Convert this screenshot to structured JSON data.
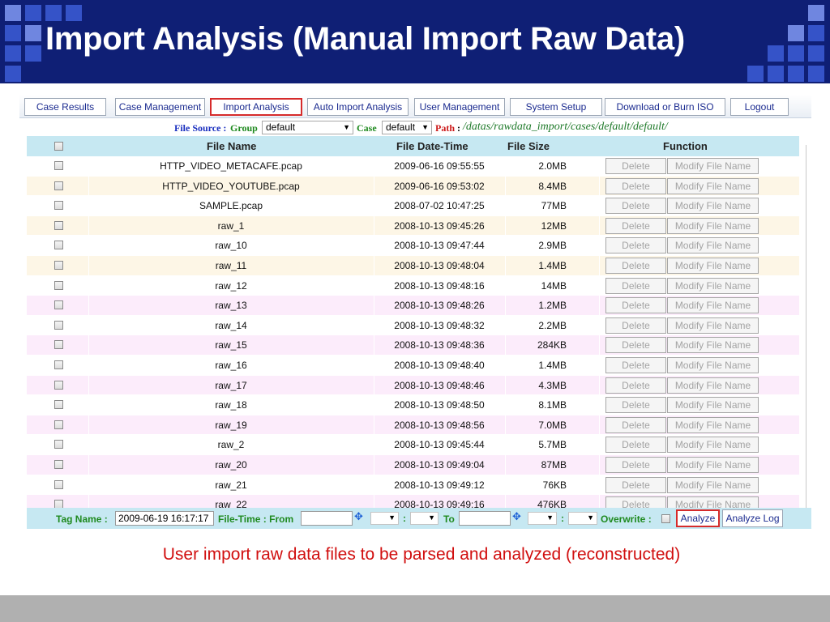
{
  "slide": {
    "title": "Import Analysis (Manual Import Raw Data)",
    "caption": "User import raw data files to be parsed and analyzed (reconstructed)"
  },
  "menu": [
    {
      "label": "Case Results"
    },
    {
      "label": "Case Management"
    },
    {
      "label": "Import Analysis"
    },
    {
      "label": "Auto Import Analysis"
    },
    {
      "label": "User Management"
    },
    {
      "label": "System Setup"
    },
    {
      "label": "Download or Burn ISO"
    },
    {
      "label": "Logout"
    }
  ],
  "source": {
    "file_source_label": "File Source :",
    "group_label": "Group",
    "group_value": "default",
    "case_label": "Case",
    "case_value": "default",
    "path_label": "Path",
    "path_colon": ":",
    "path_value": "/datas/rawdata_import/cases/default/default/"
  },
  "table": {
    "headers": {
      "file_name": "File Name",
      "file_date_time": "File Date-Time",
      "file_size": "File Size",
      "function": "Function"
    },
    "delete_label": "Delete",
    "modify_label": "Modify File Name",
    "row_colors": [
      "#ffffff",
      "#fdf6e6",
      "#ffffff",
      "#fdf6e6",
      "#ffffff",
      "#fdf6e6",
      "#ffffff",
      "#fcecfb",
      "#ffffff",
      "#fcecfb",
      "#ffffff",
      "#fcecfb",
      "#ffffff",
      "#fcecfb",
      "#ffffff",
      "#fcecfb",
      "#ffffff",
      "#fcecfb"
    ],
    "rows": [
      {
        "name": "HTTP_VIDEO_METACAFE.pcap",
        "date": "2009-06-16 09:55:55",
        "size": "2.0MB"
      },
      {
        "name": "HTTP_VIDEO_YOUTUBE.pcap",
        "date": "2009-06-16 09:53:02",
        "size": "8.4MB"
      },
      {
        "name": "SAMPLE.pcap",
        "date": "2008-07-02 10:47:25",
        "size": "77MB"
      },
      {
        "name": "raw_1",
        "date": "2008-10-13 09:45:26",
        "size": "12MB"
      },
      {
        "name": "raw_10",
        "date": "2008-10-13 09:47:44",
        "size": "2.9MB"
      },
      {
        "name": "raw_11",
        "date": "2008-10-13 09:48:04",
        "size": "1.4MB"
      },
      {
        "name": "raw_12",
        "date": "2008-10-13 09:48:16",
        "size": "14MB"
      },
      {
        "name": "raw_13",
        "date": "2008-10-13 09:48:26",
        "size": "1.2MB"
      },
      {
        "name": "raw_14",
        "date": "2008-10-13 09:48:32",
        "size": "2.2MB"
      },
      {
        "name": "raw_15",
        "date": "2008-10-13 09:48:36",
        "size": "284KB"
      },
      {
        "name": "raw_16",
        "date": "2008-10-13 09:48:40",
        "size": "1.4MB"
      },
      {
        "name": "raw_17",
        "date": "2008-10-13 09:48:46",
        "size": "4.3MB"
      },
      {
        "name": "raw_18",
        "date": "2008-10-13 09:48:50",
        "size": "8.1MB"
      },
      {
        "name": "raw_19",
        "date": "2008-10-13 09:48:56",
        "size": "7.0MB"
      },
      {
        "name": "raw_2",
        "date": "2008-10-13 09:45:44",
        "size": "5.7MB"
      },
      {
        "name": "raw_20",
        "date": "2008-10-13 09:49:04",
        "size": "87MB"
      },
      {
        "name": "raw_21",
        "date": "2008-10-13 09:49:12",
        "size": "76KB"
      },
      {
        "name": "raw_22",
        "date": "2008-10-13 09:49:16",
        "size": "476KB"
      }
    ]
  },
  "bottom": {
    "tag_name_label": "Tag Name :",
    "tag_name_value": "2009-06-19 16:17:17",
    "file_time_from_label": "File-Time : From",
    "to_label": "To",
    "time_colon": ":",
    "overwrite_label": "Overwrite :",
    "analyze_label": "Analyze",
    "analyze_log_label": "Analyze Log"
  },
  "colors": {
    "banner": "#0f1f75",
    "header_row": "#c6e8f2",
    "active_outline": "#d62b2b",
    "caption": "#d10f0f"
  }
}
